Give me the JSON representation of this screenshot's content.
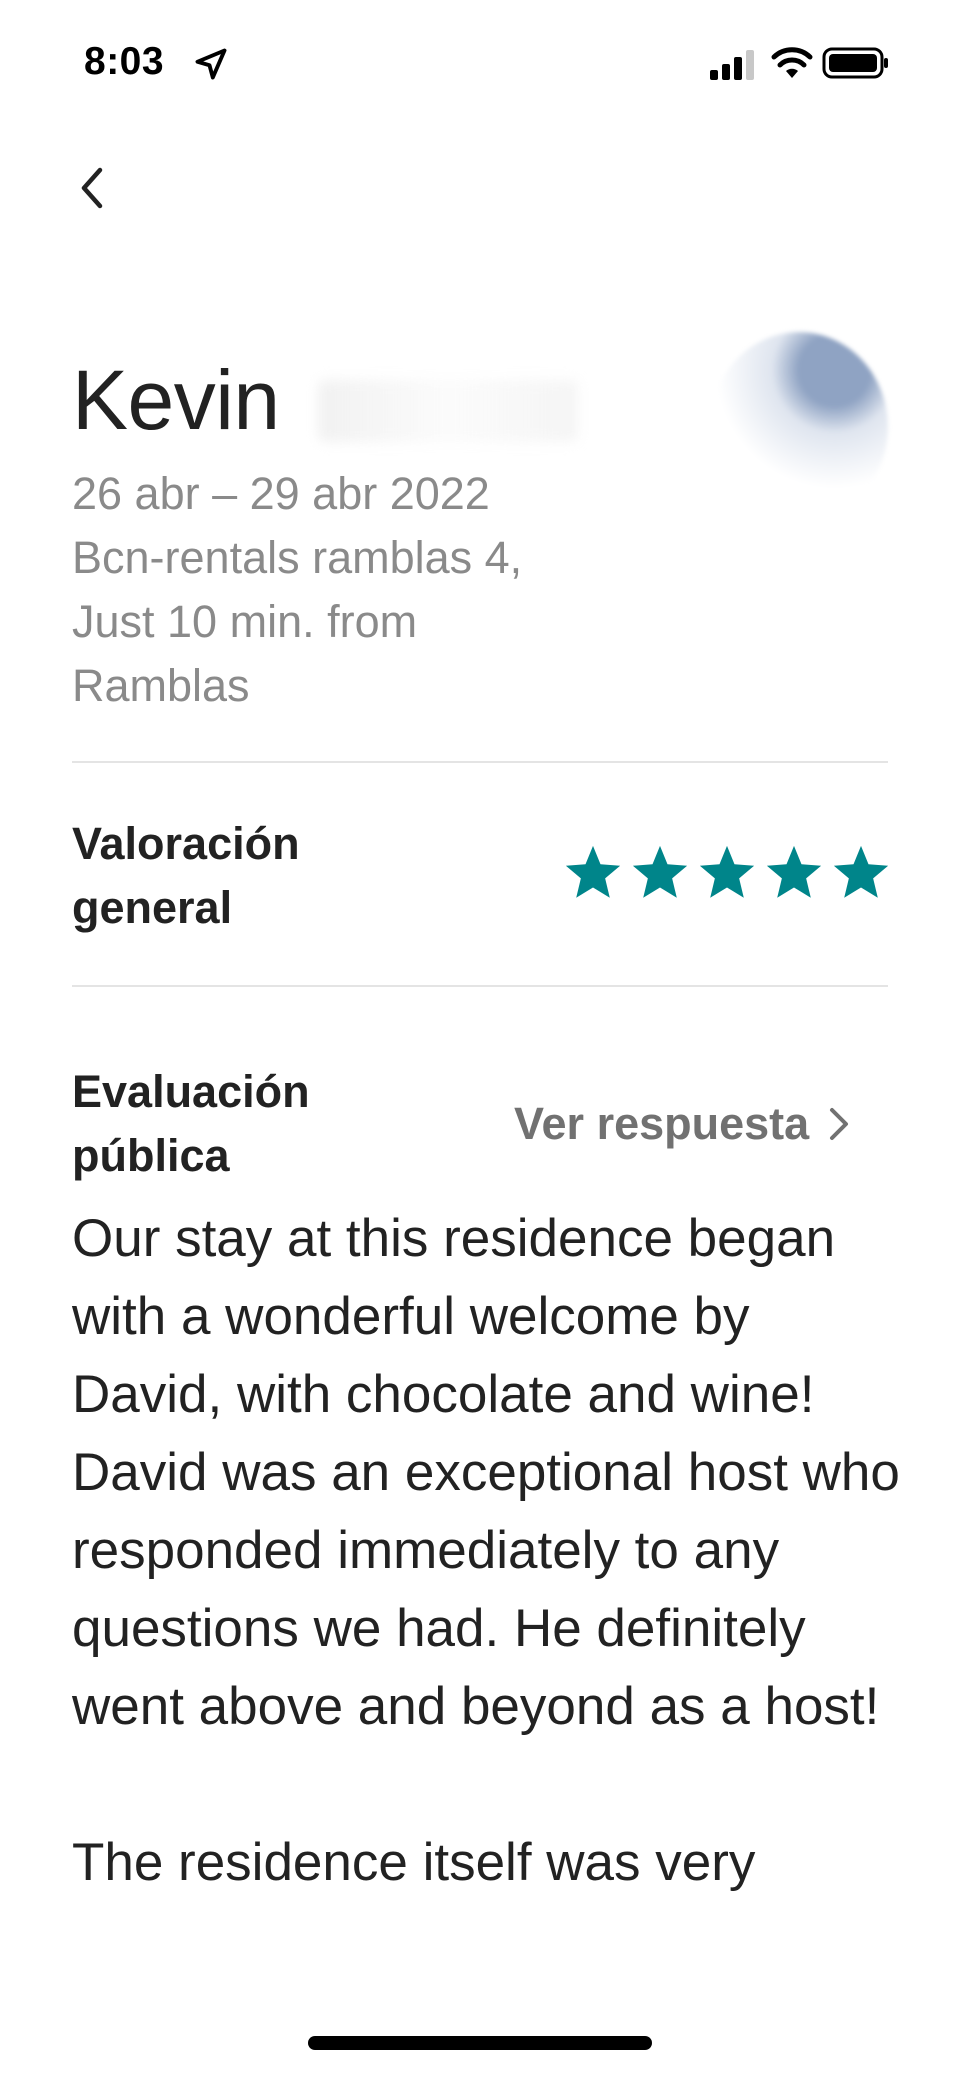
{
  "status_bar": {
    "time": "8:03",
    "icons": [
      "location-arrow-icon",
      "cellular-signal-icon",
      "wifi-icon",
      "battery-icon"
    ]
  },
  "nav": {
    "back_icon": "chevron-left-icon"
  },
  "review": {
    "guest_name": "Kevin",
    "dates": "26 abr – 29 abr 2022",
    "listing_lines": [
      "Bcn-rentals ramblas 4,",
      "Just 10 min. from",
      "Ramblas"
    ],
    "overall_rating_label_lines": [
      "Valoración",
      "general"
    ],
    "overall_rating_stars": 5,
    "overall_rating_max": 5,
    "star_color": "#00858a",
    "public_review_label_lines": [
      "Evaluación",
      "pública"
    ],
    "view_response_label": "Ver respuesta",
    "paragraphs": [
      "Our stay at this residence began with a wonderful welcome by David, with chocolate and wine! David was an exceptional host who responded immediately to any questions we had. He definitely went above and beyond as a host!",
      "The residence itself was very"
    ]
  }
}
